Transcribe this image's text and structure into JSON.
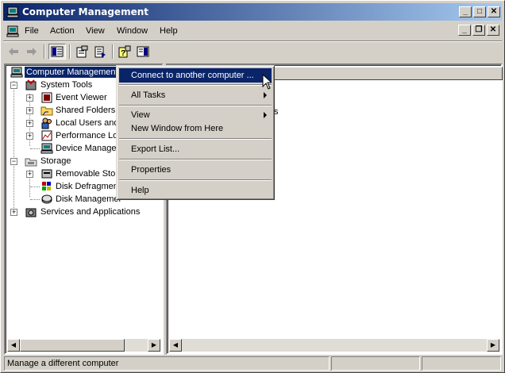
{
  "window": {
    "title": "Computer Management"
  },
  "menubar": {
    "items": [
      "File",
      "Action",
      "View",
      "Window",
      "Help"
    ]
  },
  "tree": {
    "root": "Computer Management",
    "system_tools": "System Tools",
    "event_viewer": "Event Viewer",
    "shared_folders": "Shared Folders",
    "local_users": "Local Users and",
    "performance_logs": "Performance Log",
    "device_manager": "Device Manager",
    "storage": "Storage",
    "removable_storage": "Removable Stora",
    "disk_defragmenter": "Disk Defragment",
    "disk_management": "Disk Managemer",
    "services_apps": "Services and Applications"
  },
  "right_pane": {
    "visible_fragment": "s"
  },
  "context_menu": {
    "items": [
      {
        "label": "Connect to another computer ...",
        "highlighted": true,
        "submenu": false
      },
      {
        "label": "All Tasks",
        "highlighted": false,
        "submenu": true
      },
      {
        "label": "View",
        "highlighted": false,
        "submenu": true
      },
      {
        "label": "New Window from Here",
        "highlighted": false,
        "submenu": false
      },
      {
        "label": "Export List...",
        "highlighted": false,
        "submenu": false
      },
      {
        "label": "Properties",
        "highlighted": false,
        "submenu": false
      },
      {
        "label": "Help",
        "highlighted": false,
        "submenu": false
      }
    ]
  },
  "statusbar": {
    "text": "Manage a different computer"
  },
  "colors": {
    "title_start": "#0a246a",
    "title_end": "#a6caf0",
    "highlight": "#0a246a",
    "face": "#d4d0c8"
  }
}
